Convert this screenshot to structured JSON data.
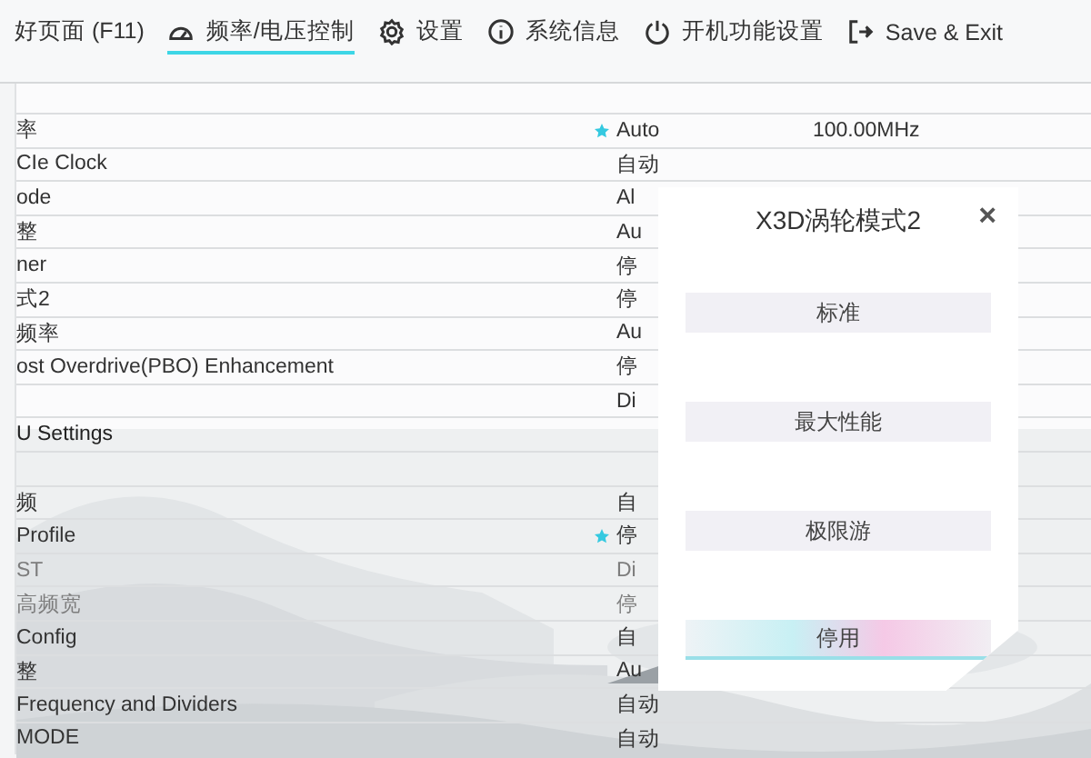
{
  "nav": [
    {
      "label": "好页面 (F11)",
      "selected": false
    },
    {
      "label": "频率/电压控制",
      "selected": true
    },
    {
      "label": "设置",
      "selected": false
    },
    {
      "label": "系统信息",
      "selected": false
    },
    {
      "label": "开机功能设置",
      "selected": false
    },
    {
      "label": "Save & Exit",
      "selected": false
    }
  ],
  "rows": [
    {
      "kind": "setting",
      "label": "率",
      "value": "Auto",
      "value_2": "100.00MHz",
      "starred": true,
      "disabled": false
    },
    {
      "kind": "setting",
      "label": "CIe Clock",
      "value": "自动",
      "starred": false,
      "disabled": false
    },
    {
      "kind": "setting",
      "label": "ode",
      "value": "Al",
      "starred": false,
      "disabled": false
    },
    {
      "kind": "setting",
      "label": "整",
      "value": "Au",
      "starred": false,
      "disabled": false
    },
    {
      "kind": "setting",
      "label": "ner",
      "value": "停",
      "starred": false,
      "disabled": false
    },
    {
      "kind": "setting",
      "label": "式2",
      "value": "停",
      "starred": false,
      "disabled": false
    },
    {
      "kind": "setting",
      "label": "频率",
      "value": "Au",
      "starred": false,
      "disabled": false
    },
    {
      "kind": "setting",
      "label": "ost Overdrive(PBO) Enhancement",
      "value": "停",
      "starred": false,
      "disabled": false
    },
    {
      "kind": "setting",
      "value": "Di",
      "starred": false,
      "disabled": false
    },
    {
      "kind": "section",
      "label": "U Settings"
    },
    {
      "kind": "blank"
    },
    {
      "kind": "setting",
      "label": "频",
      "value": "自",
      "starred": false,
      "disabled": false
    },
    {
      "kind": "setting",
      "label": "Profile",
      "value": "停",
      "starred": true,
      "disabled": false
    },
    {
      "kind": "setting",
      "label": "ST",
      "value": "Di",
      "starred": false,
      "disabled": true
    },
    {
      "kind": "setting",
      "label": "高频宽",
      "value": "停",
      "starred": false,
      "disabled": true
    },
    {
      "kind": "setting",
      "label": "Config",
      "value": "自",
      "starred": false,
      "disabled": false
    },
    {
      "kind": "setting",
      "label": "整",
      "value": "Au",
      "starred": false,
      "disabled": false
    },
    {
      "kind": "setting",
      "label": "Frequency and Dividers",
      "value": "自动",
      "starred": false,
      "disabled": false
    },
    {
      "kind": "setting",
      "label": "MODE",
      "value": "自动",
      "starred": false,
      "disabled": false
    }
  ],
  "dialog": {
    "title": "X3D涡轮模式2",
    "close": "×",
    "options": [
      {
        "label": "标准",
        "selected": false
      },
      {
        "label": "最大性能",
        "selected": false
      },
      {
        "label": "极限游",
        "selected": false
      },
      {
        "label": "停用",
        "selected": true
      }
    ]
  }
}
